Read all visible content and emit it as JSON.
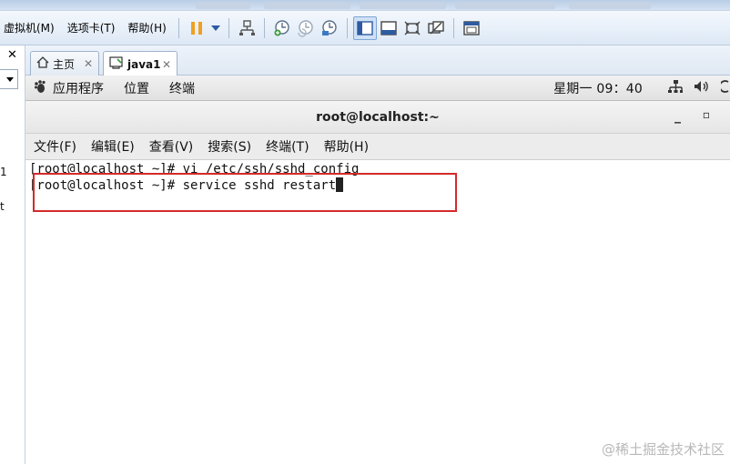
{
  "vmware": {
    "menus": [
      "虚拟机(M)",
      "选项卡(T)",
      "帮助(H)"
    ]
  },
  "tabs": [
    {
      "label": "主页",
      "icon": "home-icon",
      "active": false
    },
    {
      "label": "java1",
      "icon": "vm-icon",
      "active": true
    }
  ],
  "library": {
    "frag1": "1",
    "frag2": "t"
  },
  "gnome_panel": {
    "menus": [
      "应用程序",
      "位置",
      "终端"
    ],
    "clock": "星期一 09：40"
  },
  "terminal": {
    "title": "root@localhost:~",
    "menus": [
      "文件(F)",
      "编辑(E)",
      "查看(V)",
      "搜索(S)",
      "终端(T)",
      "帮助(H)"
    ],
    "lines": [
      "[root@localhost ~]# vi /etc/ssh/sshd_config",
      "[root@localhost ~]# service sshd restart"
    ]
  },
  "colors": {
    "highlight": "#d42a2a",
    "accent": "#3b78c4"
  },
  "watermark": "@稀土掘金技术社区"
}
